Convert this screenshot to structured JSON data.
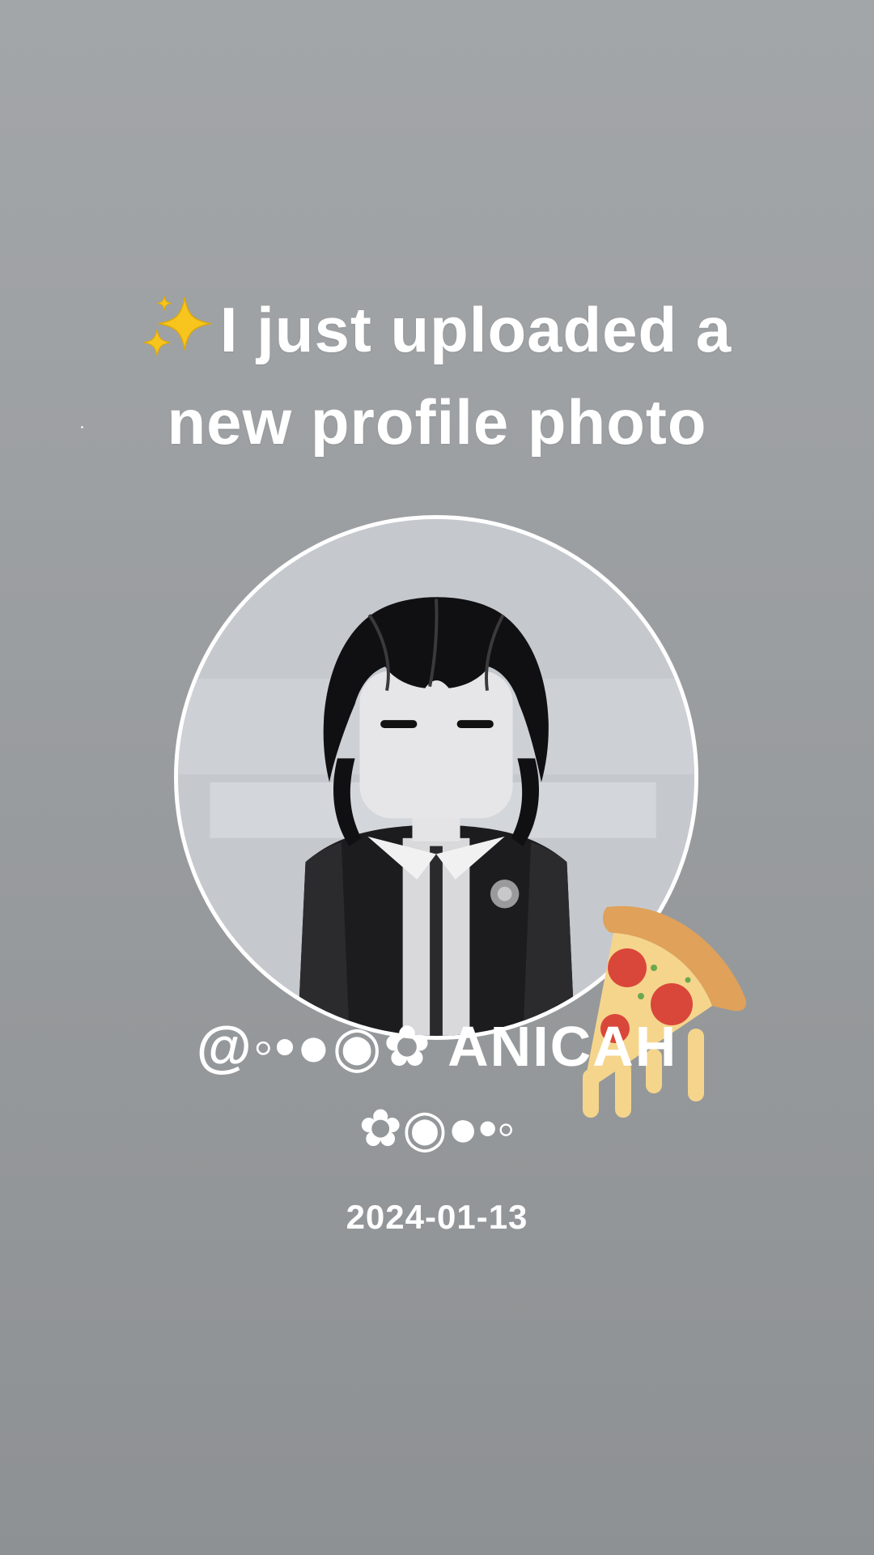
{
  "post": {
    "headline_line1": "I just uploaded a",
    "headline_line2": "new profile photo",
    "headline_icon": "sparkles-icon",
    "handle_line1": "@◦•●◉✿ ANICAH",
    "handle_line2": "✿◉●•◦",
    "date": "2024-01-13"
  },
  "avatar": {
    "icon": "profile-avatar",
    "ring_color": "#ffffff"
  },
  "sticker": {
    "icon": "pizza-slice-sticker"
  },
  "colors": {
    "background_top": "#a3a6a9",
    "background_bottom": "#8e9193",
    "text": "#ffffff"
  }
}
